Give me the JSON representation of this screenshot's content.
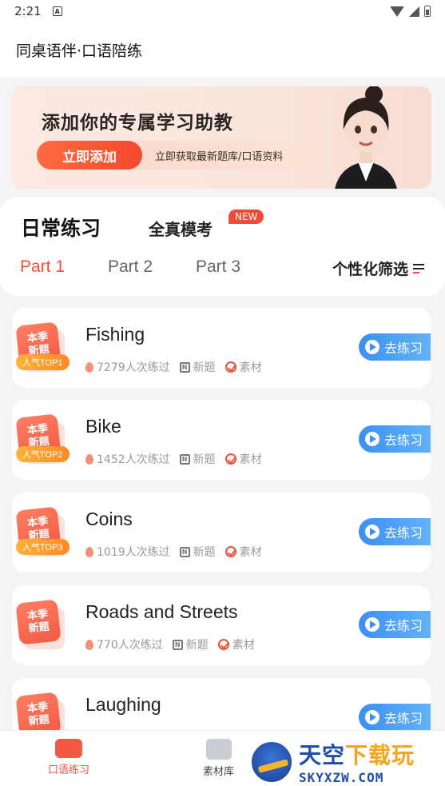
{
  "status_bar": {
    "time": "2:21",
    "a_badge": "A"
  },
  "app_bar": {
    "title": "同桌语伴·口语陪练"
  },
  "banner": {
    "title": "添加你的专属学习助教",
    "cta": "立即添加",
    "cta_sub": "立即获取最新题库/口语资料"
  },
  "tabs": {
    "daily": "日常练习",
    "mock": "全真模考",
    "new_badge": "NEW"
  },
  "parts": [
    "Part 1",
    "Part 2",
    "Part 3"
  ],
  "filter_label": "个性化筛选",
  "season_badge": [
    "本季",
    "新题"
  ],
  "meta_labels": {
    "new": "新题",
    "material": "素材"
  },
  "practice_label": "去练习",
  "cards": [
    {
      "topic": "Fishing",
      "count": "7279人次练过",
      "rank": "人气TOP1"
    },
    {
      "topic": "Bike",
      "count": "1452人次练过",
      "rank": "人气TOP2"
    },
    {
      "topic": "Coins",
      "count": "1019人次练过",
      "rank": "人气TOP3"
    },
    {
      "topic": "Roads and Streets",
      "count": "770人次练过",
      "rank": ""
    },
    {
      "topic": "Laughing",
      "count": "",
      "rank": ""
    }
  ],
  "bottom_nav": {
    "speak": "口语练习",
    "materials": "素材库"
  },
  "watermark": {
    "cn_a": "天空",
    "cn_b": "下载玩",
    "en": "SKYXZW.COM"
  },
  "colors": {
    "accent": "#f2503c",
    "button": "#3c8ff2",
    "rank": "#ff8a24"
  }
}
